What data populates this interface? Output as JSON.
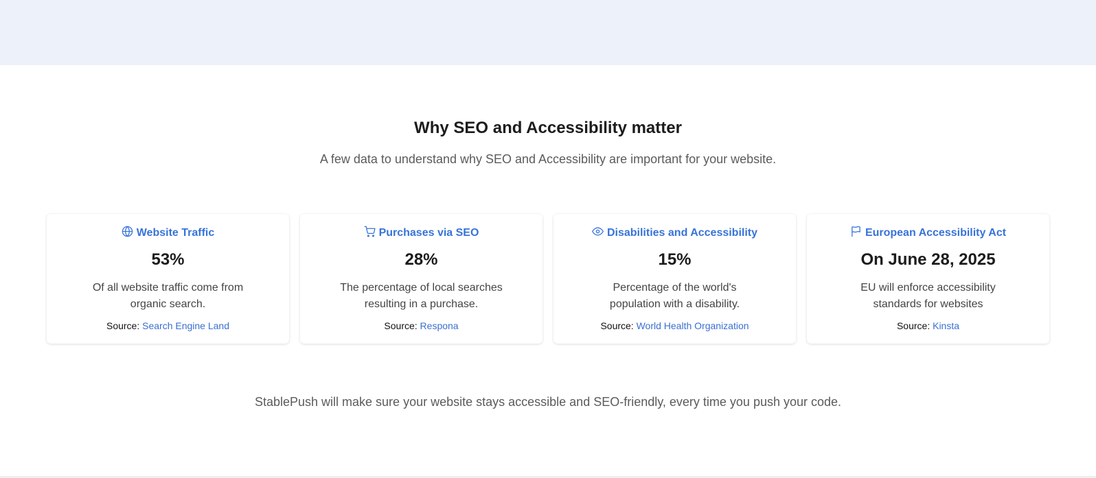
{
  "section": {
    "title": "Why SEO and Accessibility matter",
    "subtitle": "A few data to understand why SEO and Accessibility are important for your website.",
    "footer": "StablePush will make sure your website stays accessible and SEO-friendly, every time you push your code."
  },
  "colors": {
    "accent": "#3773d9",
    "top_band": "#edf1f9"
  },
  "cards": [
    {
      "icon": "globe-icon",
      "title": "Website Traffic",
      "value": "53%",
      "description": "Of all website traffic come from organic search.",
      "source_label": "Source:",
      "source_name": "Search Engine Land"
    },
    {
      "icon": "shopping-cart-icon",
      "title": "Purchases via SEO",
      "value": "28%",
      "description": "The percentage of local searches resulting in a purchase.",
      "source_label": "Source:",
      "source_name": "Respona"
    },
    {
      "icon": "eye-icon",
      "title": "Disabilities and Accessibility",
      "value": "15%",
      "description": "Percentage of the world's population with a disability.",
      "source_label": "Source:",
      "source_name": "World Health Organization"
    },
    {
      "icon": "flag-icon",
      "title": "European Accessibility Act",
      "value": "On June 28, 2025",
      "description": "EU will enforce accessibility standards for websites",
      "source_label": "Source:",
      "source_name": "Kinsta"
    }
  ]
}
